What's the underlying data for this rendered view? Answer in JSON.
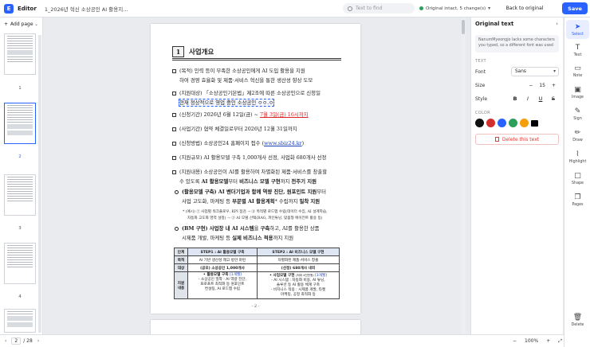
{
  "app": {
    "logo_letter": "E",
    "name": "Editor",
    "file_name": "1_2026년 혁신 소상공인 AI 활용지원 사...",
    "search_placeholder": "Text to find",
    "status": "Original intact, 5 change(s)",
    "back_label": "Back to original",
    "save_label": "Save"
  },
  "pages_panel": {
    "add_label": "Add page",
    "thumbs": [
      "1",
      "2",
      "3",
      "4"
    ]
  },
  "document": {
    "section_num": "1",
    "section_title": "사업개요",
    "items": [
      {
        "a": "(목적) 인력 ",
        "b": "등이 부족한 소상공인에게 AI 도입 활용을 지원",
        "c": "하여 경영 효율화 및 제품·서비스 혁신을 통한 생산성 향상 도모"
      },
      {
        "a": "(지원대상) 「소상공인기본법」제2조에 따른 소상공인으로 신청일",
        "b": "현재 정상적으로 영업 중인 소상공인",
        "c": "ㅇㅇ.ㅇ"
      },
      {
        "a": "(신청기간) 2026년 6월 12일(금) ~ ",
        "b": "7월 3일(금) 16시까지"
      },
      {
        "a": "(사업기간) 협약 체결일로부터 2026년 12월 31일까지"
      },
      {
        "a": "(신청방법) 소상공인24 홈페이지 접수 (",
        "b": "www.sbiz24.kr",
        "c": ")"
      },
      {
        "a": "(지원규모) AI 활용모델 구축 1,000개사 선정, 사업화 680개사 선정"
      },
      {
        "a": "(지원내용) 소상공인이 AI를 활용하여 차별화된 제품·서비스를 창출할",
        "b": "수 있도록 ",
        "c": "AI 활용모델",
        "d": "부터 ",
        "e": "비즈니스 모델 구현",
        "f": "까지 ",
        "g": "전주기 지원"
      }
    ],
    "sub1": {
      "a": "(활용모델 구축) AI 벤더기업",
      "b": "과 함께 역량 진단, 원포인트 지원",
      "c": "부터",
      "d": "사업 고도화, 마케팅 등 ",
      "e": "부문별 AI 활용계획",
      "f": "* 수립",
      "g": "까지 ",
      "h": "밀착 지원"
    },
    "note1": "* (예시) ① 사업별 워크플로우, KPI 점검 → ② 목적별 로드맵 수립(데이터 수집, AI 설계학습,",
    "note2": "자동화 고도화 영역 설정) → ③ AI 모델 선택(RAG, 파인튜닝, 맞춤형 에이전트 활용 등)",
    "sub2": {
      "a": "(BM 구현) 사업장 내 ",
      "b": "AI 시스템",
      "c": "을 ",
      "d": "구축",
      "e": "하고, AI를 활용한 상품",
      "f": "시제품 개발, 마케팅 등 ",
      "g": "실제 비즈니스 적용",
      "h": "까지 지원"
    },
    "table": {
      "col_label": "단계",
      "step1": "STEP1 : AI 활용모델 구축",
      "step2": "STEP2 : AI 비즈니스 모델 구현",
      "purpose_label": "목적",
      "purpose1": "AI 기반 생산성 제고 방안 마련",
      "purpose2": "차별화된 제품·서비스 창출",
      "target_label": "대상",
      "target1": "(공모) 소상공인 1,000개사",
      "target2": "(선정) 680개사 내외",
      "support_label": "지원\n내용",
      "s1_head": "• 활용모델 구축 ",
      "s1_tag": "[1개월]",
      "s1_body": "- 소상공인 밀착 : AI 역량 진단,\n  프로프트 최적화 등 원포인트\n  컨설팅, AI 로드맵 수립",
      "s2_head": "• 사업모델 구현 ",
      "s2_small": "(최대 4천만원) ",
      "s2_tag": "[3개월]",
      "s2_body": "- AI 시스템 : 자동화 비용, AI 튜닝,\n  솔루션 등 AI 활용 체계 구축\n- 비지니스 적용 : 시제품 개발, 타켓\n  마케팅, 공정 최적화 등"
    },
    "page_footer": "- 2 -"
  },
  "right_panel": {
    "title": "Original text",
    "warning": "NanumMyeongjo lacks some characters you typed, so a different font was used",
    "text_section": "TEXT",
    "font_label": "Font",
    "font_value": "Sans",
    "size_label": "Size",
    "size_minus": "−",
    "size_value": "15",
    "size_plus": "+",
    "style_label": "Style",
    "style_b": "B",
    "style_i": "I",
    "style_u": "U",
    "style_s": "S",
    "color_section": "COLOR",
    "colors": [
      "#111111",
      "#d32f2f",
      "#2962ff",
      "#2e9e5b",
      "#f59e0b",
      "#000000"
    ],
    "delete_label": "Delete this text"
  },
  "tools": {
    "select": "Select",
    "text": "Text",
    "note": "Note",
    "image": "Image",
    "sign": "Sign",
    "draw": "Draw",
    "highlight": "Highlight",
    "shape": "Shape",
    "pages": "Pages",
    "delete": "Delete"
  },
  "bottom": {
    "page_current": "2",
    "page_total": "/ 28",
    "zoom_value": "100%",
    "zoom_minus": "−",
    "zoom_plus": "+"
  }
}
